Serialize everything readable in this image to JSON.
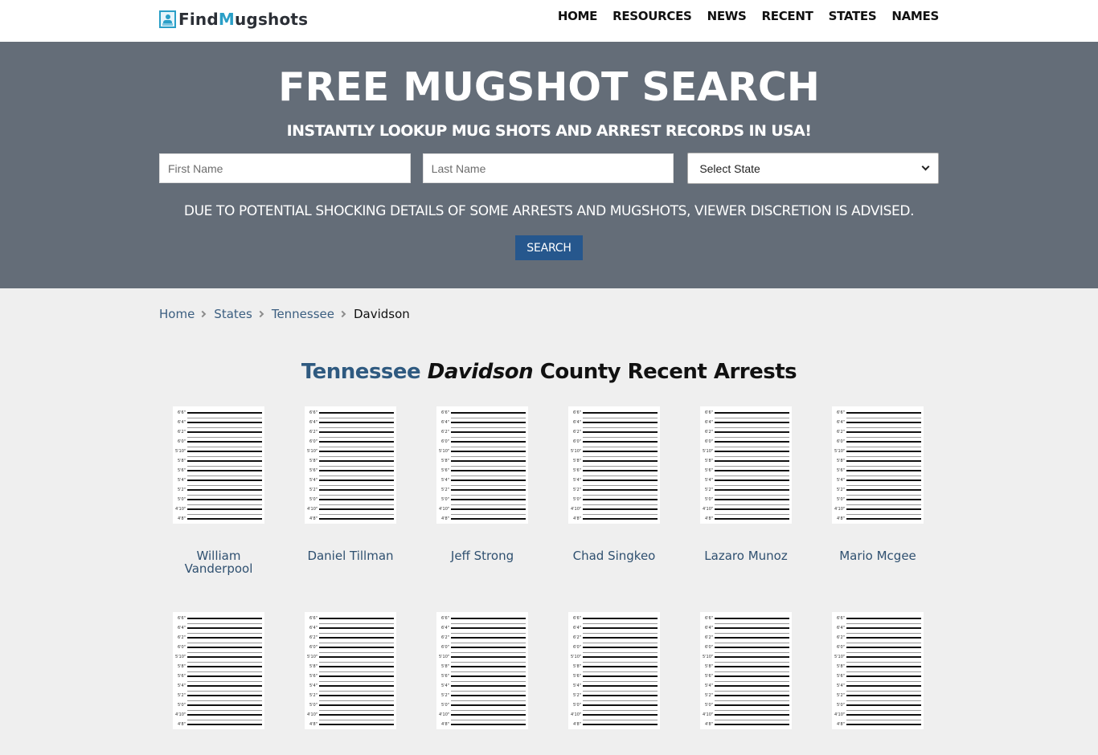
{
  "header": {
    "logo": {
      "prefix": "Find",
      "highlight": "M",
      "suffix": "ugshots",
      "icon": "id-card-icon"
    },
    "nav": [
      "HOME",
      "RESOURCES",
      "NEWS",
      "RECENT",
      "STATES",
      "NAMES"
    ]
  },
  "hero": {
    "title": "FREE MUGSHOT SEARCH",
    "subtitle": "INSTANTLY LOOKUP MUG SHOTS AND ARREST RECORDS IN USA!",
    "first_name_placeholder": "First Name",
    "last_name_placeholder": "Last Name",
    "state_select_value": "Select State",
    "warning": "DUE TO POTENTIAL SHOCKING DETAILS OF SOME ARRESTS AND MUGSHOTS, VIEWER DISCRETION IS ADVISED.",
    "search_button": "SEARCH"
  },
  "breadcrumb": {
    "items": [
      "Home",
      "States",
      "Tennessee"
    ],
    "current": "Davidson"
  },
  "page_title": {
    "state": "Tennessee",
    "county": "Davidson",
    "suffix": "County Recent Arrests"
  },
  "height_chart_labels": [
    "6'6\"",
    "6'4\"",
    "6'2\"",
    "6'0\"",
    "5'10\"",
    "5'8\"",
    "5'6\"",
    "5'4\"",
    "5'2\"",
    "5'0\"",
    "4'10\"",
    "4'8\""
  ],
  "arrests": [
    {
      "name": "William Vanderpool"
    },
    {
      "name": "Daniel Tillman"
    },
    {
      "name": "Jeff Strong"
    },
    {
      "name": "Chad Singkeo"
    },
    {
      "name": "Lazaro Munoz"
    },
    {
      "name": "Mario Mcgee"
    },
    {
      "name": ""
    },
    {
      "name": ""
    },
    {
      "name": ""
    },
    {
      "name": ""
    },
    {
      "name": ""
    },
    {
      "name": ""
    }
  ]
}
